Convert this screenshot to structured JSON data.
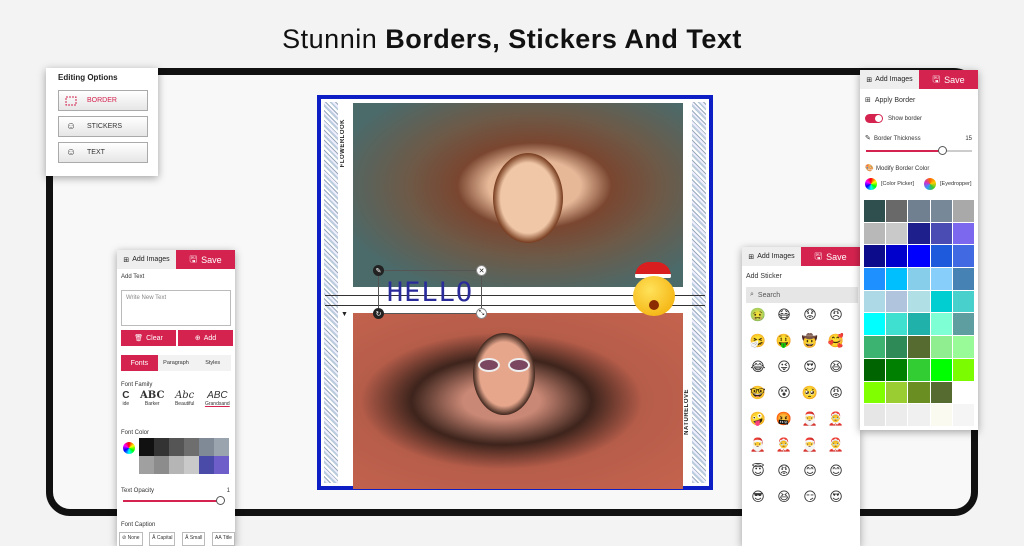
{
  "headline": {
    "prefix": "Stunnin ",
    "bold": "Borders, Stickers And Text"
  },
  "editing_options": {
    "title": "Editing Options",
    "items": [
      {
        "label": "BORDER",
        "icon": "border-icon",
        "active": true
      },
      {
        "label": "STICKERS",
        "icon": "smiley-icon",
        "active": false
      },
      {
        "label": "TEXT",
        "icon": "smiley-icon",
        "active": false
      }
    ]
  },
  "canvas": {
    "text_overlay": "HELLO",
    "side_text_top": "FLOWERLOOK",
    "side_text_bottom": "NATURELOVE",
    "border_color": "#0d1fc4"
  },
  "text_panel": {
    "tab_add": "Add Images",
    "tab_save": "Save",
    "section_add_text": "Add Text",
    "input_placeholder": "Write New Text",
    "clear_label": "Clear",
    "add_label": "Add",
    "tabs": [
      "Fonts",
      "Paragraph",
      "Styles"
    ],
    "font_family_label": "Font Family",
    "fonts": [
      {
        "sample": "C",
        "name": "ide"
      },
      {
        "sample": "ABC",
        "name": "Barker"
      },
      {
        "sample": "Abc",
        "name": "Beautiful"
      },
      {
        "sample": "ABC",
        "name": "Grandsand"
      }
    ],
    "font_color_label": "Font Color",
    "text_opacity_label": "Text Opacity",
    "text_opacity_value": "1",
    "text_opacity_fraction": 0.97,
    "font_caption_label": "Font Caption",
    "captions": [
      "None",
      "Capital",
      "Small",
      "Title"
    ],
    "color_swatches": [
      "#111111",
      "#333333",
      "#555555",
      "#6e6e6e",
      "#7f8a96",
      "#9aa4ae",
      "#a0a0a0",
      "#8c8c8c",
      "#b5b5b5",
      "#c9c9c9",
      "#4a4aa8",
      "#6e5ec9"
    ]
  },
  "sticker_panel": {
    "tab_add": "Add Images",
    "tab_save": "Save",
    "title": "Add Sticker",
    "search_placeholder": "Search",
    "emojis": [
      "🤢",
      "😷",
      "😟",
      "😠",
      "🤧",
      "🤑",
      "🤠",
      "🥰",
      "😂",
      "😜",
      "😍",
      "😆",
      "🤓",
      "😵",
      "🥺",
      "😡",
      "🤪",
      "🤬",
      "🎅",
      "🤶",
      "🎅",
      "🤶",
      "🎅",
      "🤶",
      "😇",
      "😡",
      "😊",
      "😊",
      "😎",
      "😆",
      "😏",
      "😍"
    ]
  },
  "border_panel": {
    "tab_add": "Add Images",
    "tab_save": "Save",
    "apply_border": "Apply Border",
    "show_border": "Show border",
    "border_thickness": "Border Thickness",
    "border_thickness_value": "15",
    "border_thickness_fraction": 0.72,
    "modify_border_color": "Modify Border Color",
    "color_picker": "[Color Picker]",
    "eyedropper": "[Eyedropper]",
    "palette": [
      "#2f4f4f",
      "#696969",
      "#708090",
      "#778899",
      "#a9a9a9",
      "#b8b8b8",
      "#c9c9c9",
      "#1e1e8c",
      "#4b4bb4",
      "#7b68ee",
      "#0b0b8b",
      "#0000cd",
      "#0000ff",
      "#1e5adc",
      "#4169e1",
      "#1e90ff",
      "#00bfff",
      "#87ceeb",
      "#87cefa",
      "#4682b4",
      "#add8e6",
      "#b0c4de",
      "#b0e0e6",
      "#00ced1",
      "#48d1cc",
      "#00ffff",
      "#40e0d0",
      "#20b2aa",
      "#7fffd4",
      "#5f9ea0",
      "#3cb371",
      "#2e8b57",
      "#556b2f",
      "#90ee90",
      "#98fb98",
      "#006400",
      "#008000",
      "#32cd32",
      "#00ff00",
      "#7cfc00",
      "#7fff00",
      "#9acd32",
      "#6b8e23",
      "#556b2f",
      "#ffffff",
      "#e6e6e6",
      "#ececec",
      "#f0f0f0",
      "#fafaf0",
      "#f5f5f5"
    ]
  }
}
